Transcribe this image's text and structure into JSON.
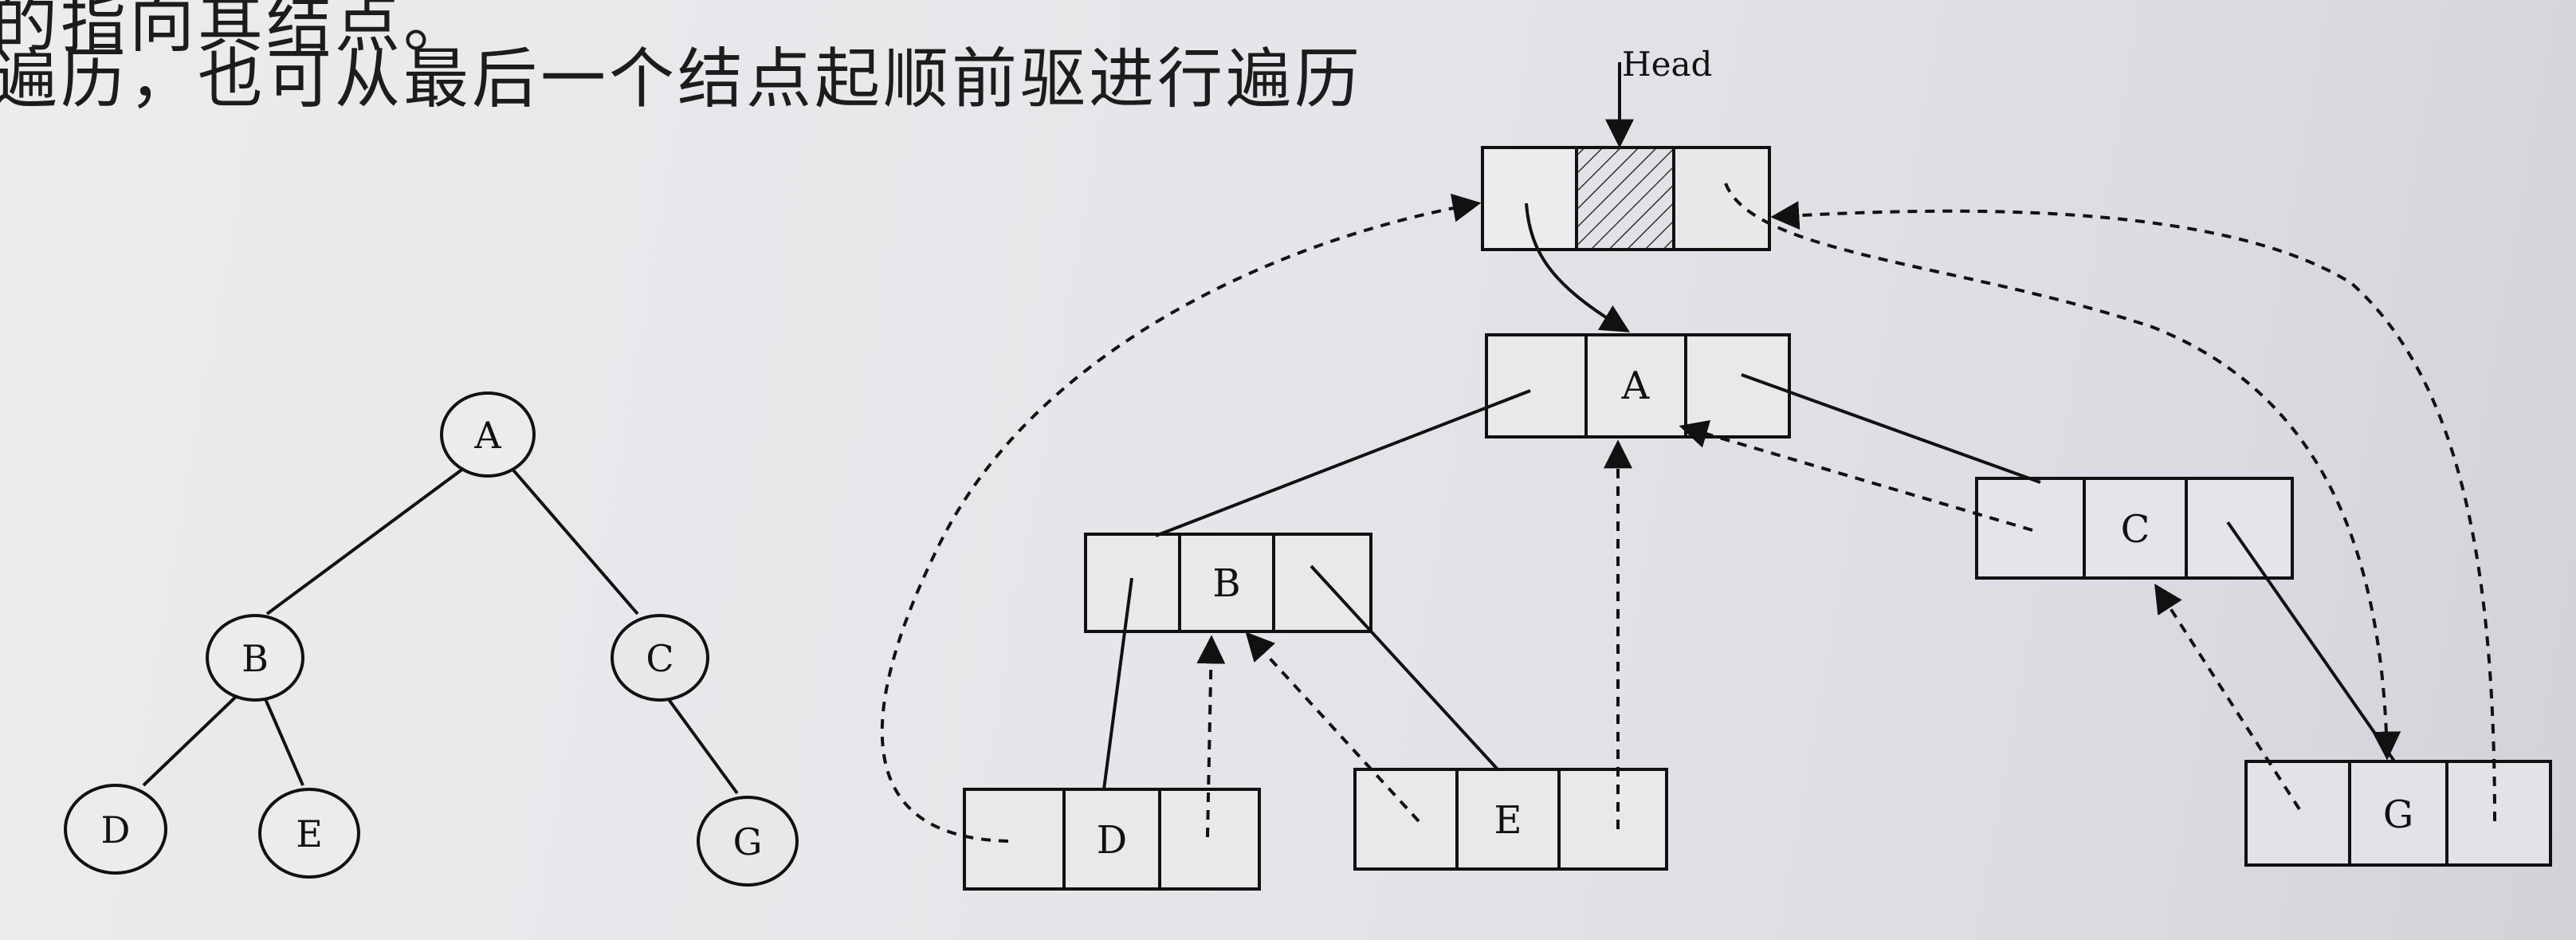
{
  "page_text": {
    "line1": "的指向其结点。",
    "line2": "遍历，也可从最后一个结点起顺前驱进行遍历"
  },
  "diagram": {
    "head_label": "Head",
    "tree": {
      "nodes": [
        "A",
        "B",
        "C",
        "D",
        "E",
        "G"
      ],
      "edges": [
        [
          "A",
          "B"
        ],
        [
          "A",
          "C"
        ],
        [
          "B",
          "D"
        ],
        [
          "B",
          "E"
        ],
        [
          "C",
          "G"
        ]
      ]
    },
    "threaded_nodes": [
      "A",
      "B",
      "C",
      "D",
      "E",
      "G"
    ]
  }
}
